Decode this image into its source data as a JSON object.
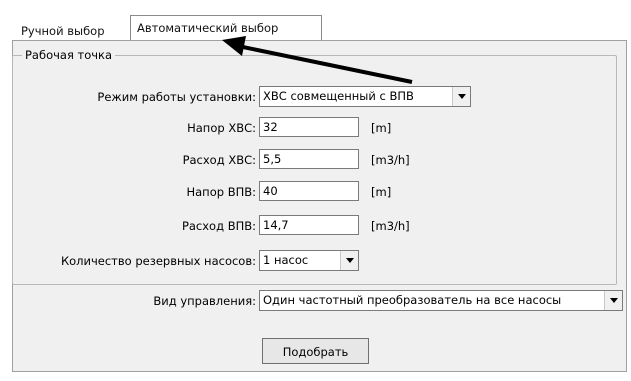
{
  "tabs": {
    "manual": "Ручной выбор",
    "auto": "Автоматический выбор"
  },
  "group": {
    "title": "Рабочая точка"
  },
  "mode": {
    "label": "Режим работы установки:",
    "value": "ХВС совмещенный с ВПВ"
  },
  "head_hws": {
    "label": "Напор ХВС:",
    "value": "32",
    "unit": "[m]"
  },
  "flow_hws": {
    "label": "Расход ХВС:",
    "value": "5,5",
    "unit": "[m3/h]"
  },
  "head_fire": {
    "label": "Напор ВПВ:",
    "value": "40",
    "unit": "[m]"
  },
  "flow_fire": {
    "label": "Расход ВПВ:",
    "value": "14,7",
    "unit": "[m3/h]"
  },
  "reserve": {
    "label": "Количество резервных насосов:",
    "value": "1 насос"
  },
  "control": {
    "label": "Вид управления:",
    "value": "Один частотный преобразователь на все насосы"
  },
  "submit_label": "Подобрать",
  "annotation": {
    "icon": "arrow-pointer-icon",
    "color": "#000000"
  }
}
